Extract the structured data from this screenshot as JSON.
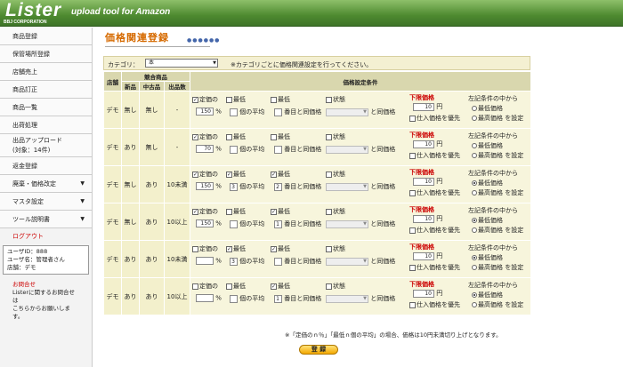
{
  "app": {
    "logo": "Lister",
    "tagline": "upload tool for Amazon",
    "corp": "BBJ CORPORATION"
  },
  "sidebar": {
    "items": [
      {
        "label": "商品登録",
        "arrow": ""
      },
      {
        "label": "保管場所登録",
        "arrow": ""
      },
      {
        "label": "店舗売上",
        "arrow": ""
      },
      {
        "label": "商品訂正",
        "arrow": ""
      },
      {
        "label": "商品一覧",
        "arrow": ""
      },
      {
        "label": "出荷処理",
        "arrow": ""
      },
      {
        "label": "出品アップロード",
        "label2": "(対象：14件)",
        "arrow": ""
      },
      {
        "label": "返金登録",
        "arrow": ""
      },
      {
        "label": "廃棄・価格改定",
        "arrow": "▼"
      },
      {
        "label": "マスタ設定",
        "arrow": "▼"
      },
      {
        "label": "ツール説明書",
        "arrow": "▼"
      }
    ],
    "logout": "ログアウト",
    "user": {
      "id": "ユーザID：888",
      "name": "ユーザ名：管理者さん",
      "store": "店舗：デモ"
    },
    "contact": {
      "title": "お問合せ",
      "line1": "Listerに関するお問合せは",
      "line2": "こちらからお願いします。"
    }
  },
  "page": {
    "title": "価格関連登録",
    "dots": "●●●●●●"
  },
  "category": {
    "label": "カテゴリ：",
    "selected": "本",
    "note": "※カテゴリごとに価格関連設定を行ってください。"
  },
  "table": {
    "headers": {
      "store": "店舗",
      "competitor": "競合商品",
      "config": "価格設定条件",
      "new": "新品",
      "used": "中古品",
      "count": "出品数"
    },
    "labels": {
      "fixed": "定価の",
      "pct": "%",
      "lowest": "最低",
      "avg": "個の平均",
      "rank": "番目と同価格",
      "cond": "状態",
      "same": "と同価格",
      "limit": "下限価格",
      "yen": "円",
      "prefer": "仕入価格を優先",
      "from": "左記条件の中から",
      "min": "最低価格",
      "max": "最高価格",
      "set": "を設定"
    },
    "rows": [
      {
        "store": "デモ",
        "new": "無し",
        "used": "無し",
        "count": "-",
        "pct": "150",
        "fixed": true,
        "lowest1": false,
        "avg_n": "",
        "lowest2": false,
        "rank_n": "",
        "cond": false,
        "limit": "10",
        "prefer": false,
        "pick": "none"
      },
      {
        "store": "デモ",
        "new": "あり",
        "used": "無し",
        "count": "-",
        "pct": "70",
        "fixed": true,
        "lowest1": false,
        "avg_n": "",
        "lowest2": false,
        "rank_n": "",
        "cond": false,
        "limit": "10",
        "prefer": false,
        "pick": "none"
      },
      {
        "store": "デモ",
        "new": "無し",
        "used": "あり",
        "count": "10未満",
        "pct": "150",
        "fixed": true,
        "lowest1": true,
        "avg_n": "3",
        "lowest2": true,
        "rank_n": "2",
        "cond": false,
        "limit": "10",
        "prefer": false,
        "pick": "min"
      },
      {
        "store": "デモ",
        "new": "無し",
        "used": "あり",
        "count": "10以上",
        "pct": "150",
        "fixed": true,
        "lowest1": false,
        "avg_n": "",
        "lowest2": true,
        "rank_n": "1",
        "cond": false,
        "limit": "10",
        "prefer": false,
        "pick": "min"
      },
      {
        "store": "デモ",
        "new": "あり",
        "used": "あり",
        "count": "10未満",
        "pct": "",
        "fixed": false,
        "lowest1": true,
        "avg_n": "3",
        "lowest2": true,
        "rank_n": "",
        "cond": false,
        "limit": "10",
        "prefer": false,
        "pick": "min"
      },
      {
        "store": "デモ",
        "new": "あり",
        "used": "あり",
        "count": "10以上",
        "pct": "",
        "fixed": false,
        "lowest1": false,
        "avg_n": "",
        "lowest2": true,
        "rank_n": "1",
        "cond": false,
        "limit": "10",
        "prefer": false,
        "pick": "min"
      }
    ]
  },
  "footnote": "※「定価のｎ％」「最低ｎ個の平均」の場合、価格は10円未満切り上げとなります。",
  "register": "登 録"
}
